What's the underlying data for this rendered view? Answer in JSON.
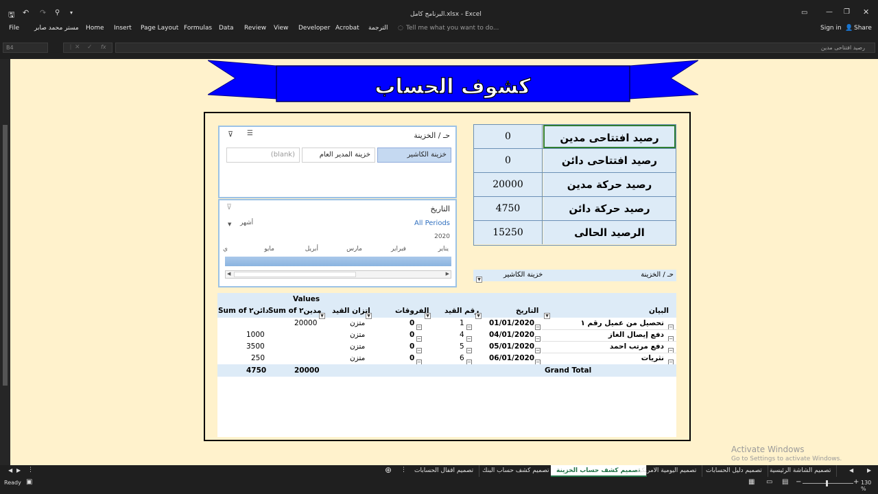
{
  "window": {
    "title": "البرنامج كامل.xlsx - Excel"
  },
  "menu": {
    "file": "File",
    "user": "مستر محمد صابر",
    "home": "Home",
    "insert": "Insert",
    "page_layout": "Page Layout",
    "formulas": "Formulas",
    "data": "Data",
    "review": "Review",
    "view": "View",
    "developer": "Developer",
    "acrobat": "Acrobat",
    "translate": "الترجمة",
    "tell_me": "Tell me what you want to do...",
    "sign_in": "Sign in",
    "share": "Share"
  },
  "formula_bar": {
    "name_box": "B4",
    "formula": "رصيد افتتاحى مدين"
  },
  "banner": {
    "title": "كشوف الحساب"
  },
  "balances": [
    {
      "label": "رصيد افتتاحى مدين",
      "value": "0"
    },
    {
      "label": "رصيد افتتاحى دائن",
      "value": "0"
    },
    {
      "label": "رصيد حركة مدين",
      "value": "20000"
    },
    {
      "label": "رصيد حركة دائن",
      "value": "4750"
    },
    {
      "label": "الرصيد الحالى",
      "value": "15250"
    }
  ],
  "slicer_safe": {
    "title": "حـ / الخزينة",
    "items": [
      "خزينة الكاشير",
      "خزينة المدير العام",
      "(blank)"
    ]
  },
  "timeline": {
    "title": "التاريخ",
    "all_periods": "All Periods",
    "level": "أشهر",
    "year": "2020",
    "months": [
      "يناير",
      "فبراير",
      "مارس",
      "أبريل",
      "مايو",
      "ي"
    ]
  },
  "filter": {
    "label": "حـ / الخزينة",
    "value": "خزينة الكاشير"
  },
  "pivot": {
    "values_label": "Values",
    "headers": {
      "desc": "البيان",
      "date": "التاريخ",
      "entry": "رقم القيد",
      "diff": "الفروقات",
      "balance": "اتزان القيد",
      "debit": "Sum of مدين٢",
      "credit": "Sum of دائن٢"
    },
    "rows": [
      {
        "desc": "تحصيل من عميل رقم ١",
        "date": "01/01/2020",
        "entry": "1",
        "diff": "0",
        "balance": "متزن",
        "debit": "20000",
        "credit": ""
      },
      {
        "desc": "دفع إيصال الغاز",
        "date": "04/01/2020",
        "entry": "4",
        "diff": "0",
        "balance": "متزن",
        "debit": "",
        "credit": "1000"
      },
      {
        "desc": "دفع مرتب احمد",
        "date": "05/01/2020",
        "entry": "5",
        "diff": "0",
        "balance": "متزن",
        "debit": "",
        "credit": "3500"
      },
      {
        "desc": "نثريات",
        "date": "06/01/2020",
        "entry": "6",
        "diff": "0",
        "balance": "متزن",
        "debit": "",
        "credit": "250"
      }
    ],
    "total": {
      "label": "Grand Total",
      "debit": "20000",
      "credit": "4750"
    }
  },
  "tabs": [
    "تصميم الشاشة الرئيسية",
    "تصميم دليل الحسابات",
    "تصميم اليومية الامريكية",
    "تصميم كشف حساب الخزينة",
    "تصميم كشف حساب البنك",
    "تصميم اقفال الحسابات"
  ],
  "status": {
    "ready": "Ready",
    "zoom": "130 %"
  },
  "watermark": {
    "line1": "Activate Windows",
    "line2": "Go to Settings to activate Windows."
  },
  "colors": {
    "accent_blue": "#0000ff",
    "sheet_bg": "#fff2cc",
    "table_fill": "#ddebf7"
  }
}
